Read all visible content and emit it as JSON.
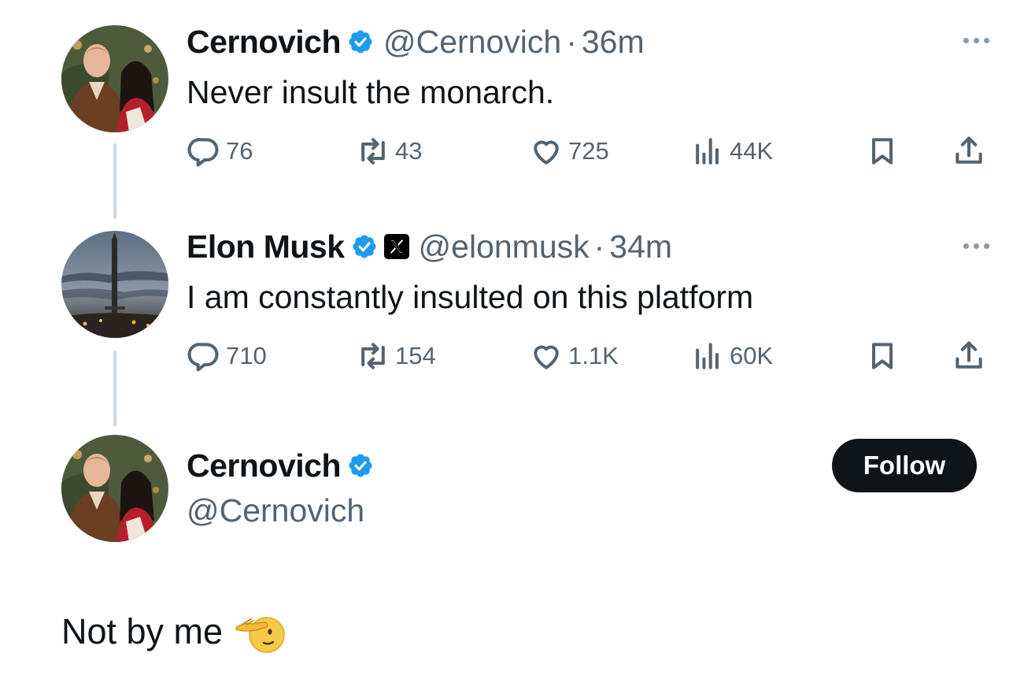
{
  "tweet1": {
    "name": "Cernovich",
    "handle": "@Cernovich",
    "time": "36m",
    "text": "Never insult the monarch.",
    "stats": {
      "replies": "76",
      "reposts": "43",
      "likes": "725",
      "views": "44K"
    }
  },
  "tweet2": {
    "name": "Elon Musk",
    "handle": "@elonmusk",
    "time": "34m",
    "text": "I am constantly insulted on this platform",
    "stats": {
      "replies": "710",
      "reposts": "154",
      "likes": "1.1K",
      "views": "60K"
    }
  },
  "profile": {
    "name": "Cernovich",
    "handle": "@Cernovich",
    "follow_label": "Follow"
  },
  "reply": {
    "text": "Not by me",
    "emoji": "saluting-face-emoji"
  },
  "separator": "·",
  "colors": {
    "verified": "#1d9bf0",
    "text": "#0f1419",
    "secondary": "#536471",
    "thread_line": "#cfd9de"
  },
  "icons": [
    "reply-icon",
    "repost-icon",
    "like-icon",
    "views-icon",
    "bookmark-icon",
    "share-icon",
    "more-icon",
    "verified-badge-icon",
    "x-affiliation-icon"
  ]
}
